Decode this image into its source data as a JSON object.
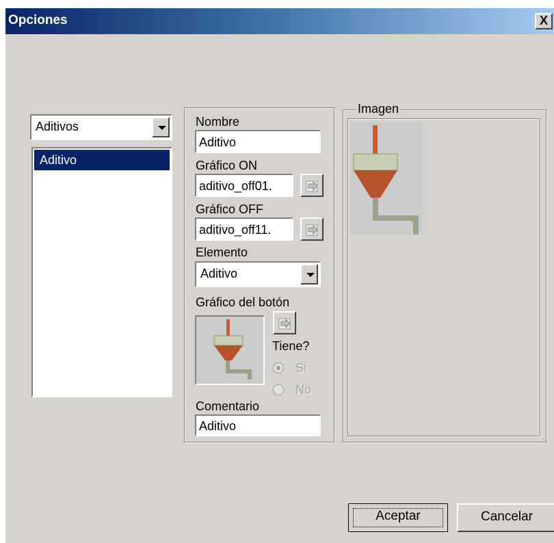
{
  "window": {
    "title": "Opciones",
    "close_symbol": "X"
  },
  "left": {
    "category_select": {
      "value": "Aditivos"
    },
    "items": [
      {
        "label": "Aditivo",
        "selected": true
      }
    ]
  },
  "form": {
    "nombre_label": "Nombre",
    "nombre_value": "Aditivo",
    "grafico_on_label": "Gráfico ON",
    "grafico_on_value": "aditivo_off01.",
    "grafico_off_label": "Gráfico OFF",
    "grafico_off_value": "aditivo_off11.",
    "elemento_label": "Elemento",
    "elemento_value": "Aditivo",
    "grafico_boton_label": "Gráfico del botón",
    "tiene_label": "Tiene?",
    "radio_si_label": "Sí",
    "radio_no_label": "No",
    "radio_selected": "Sí",
    "comentario_label": "Comentario",
    "comentario_value": "Aditivo"
  },
  "image_group": {
    "title": "Imagen",
    "icon": "additive-hopper-icon"
  },
  "buttons": {
    "accept": "Aceptar",
    "cancel": "Cancelar"
  },
  "colors": {
    "titlebar_start": "#0a246a",
    "titlebar_end": "#a6caf0",
    "dialog_face": "#d6d3ce",
    "selection": "#0a246a",
    "hopper_body": "#c9cfb4",
    "hopper_cone": "#b5532c",
    "pipe": "#d55a2a"
  }
}
